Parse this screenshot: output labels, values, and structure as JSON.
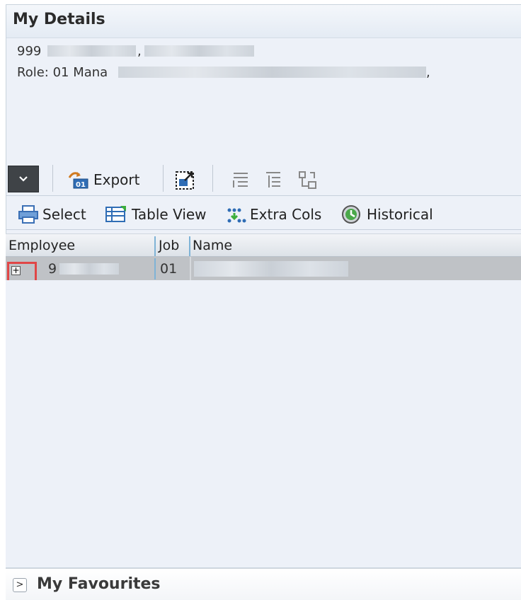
{
  "panel": {
    "title": "My Details",
    "id_prefix": "999",
    "id_suffix": ",",
    "role_prefix": "Role: 01 Mana",
    "role_suffix": ","
  },
  "toolbar": {
    "collapse_icon": "chevron-down-icon",
    "export_label": "Export"
  },
  "toolbar2": {
    "select_label": "Select",
    "table_view_label": "Table View",
    "extra_cols_label": "Extra Cols",
    "historical_label": "Historical"
  },
  "grid": {
    "columns": [
      "Employee",
      "Job",
      "Name"
    ],
    "rows": [
      {
        "employee": "9",
        "job": "01",
        "name": ""
      }
    ]
  },
  "favourites": {
    "label": "My Favourites"
  },
  "colors": {
    "panel_bg": "#edf1f8",
    "row_selected": "#bfc2c6",
    "highlight": "#e04646",
    "column_divider": "#7fb3d6"
  }
}
